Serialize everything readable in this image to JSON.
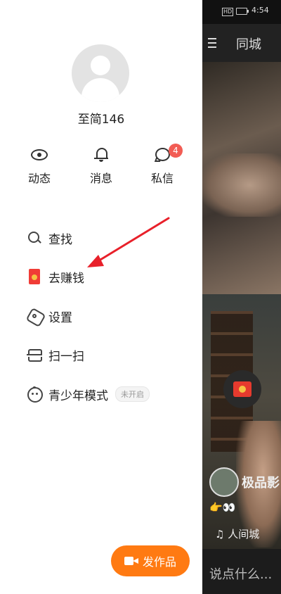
{
  "status_bar": {
    "network": "HD",
    "time": "4:54"
  },
  "feed": {
    "top_tab": "同城",
    "author_name": "极品影",
    "emoji_line": "👉👀",
    "music": "♫ 人间城",
    "comment_placeholder": "说点什么..."
  },
  "drawer": {
    "username": "至简146",
    "quick_actions": [
      {
        "label": "动态",
        "icon": "eye-icon"
      },
      {
        "label": "消息",
        "icon": "bell-icon"
      },
      {
        "label": "私信",
        "icon": "chat-bubble-icon",
        "badge": "4"
      }
    ],
    "menu": [
      {
        "label": "查找",
        "icon": "search-icon"
      },
      {
        "label": "去赚钱",
        "icon": "red-packet-icon"
      },
      {
        "label": "设置",
        "icon": "settings-hex-icon"
      },
      {
        "label": "扫一扫",
        "icon": "scan-icon"
      },
      {
        "label": "青少年模式",
        "icon": "kid-face-icon",
        "tag": "未开启"
      }
    ],
    "publish_button": "发作品"
  },
  "colors": {
    "accent_orange": "#ff7a12",
    "badge_red": "#f25c54",
    "arrow_red": "#e8202a",
    "red_packet": "#f03c36"
  }
}
